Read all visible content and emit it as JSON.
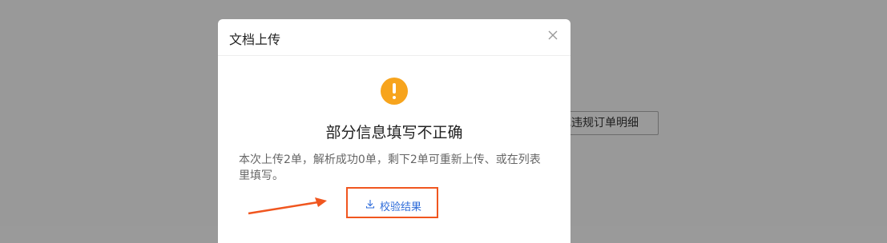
{
  "background": {
    "button_label": "或违规订单明细"
  },
  "modal": {
    "title": "文档上传",
    "close_icon": "close-icon",
    "result": {
      "icon": "exclamation-warning-icon",
      "title": "部分信息填写不正确",
      "description": "本次上传2单，解析成功0单，剩下2单可重新上传、或在列表里填写。"
    },
    "download": {
      "icon": "download-icon",
      "label": "校验结果"
    }
  },
  "annotation": {
    "highlight_color": "#f0561f"
  },
  "colors": {
    "warning": "#f7a41d",
    "link": "#2d6bd9",
    "overlay": "#999999"
  }
}
